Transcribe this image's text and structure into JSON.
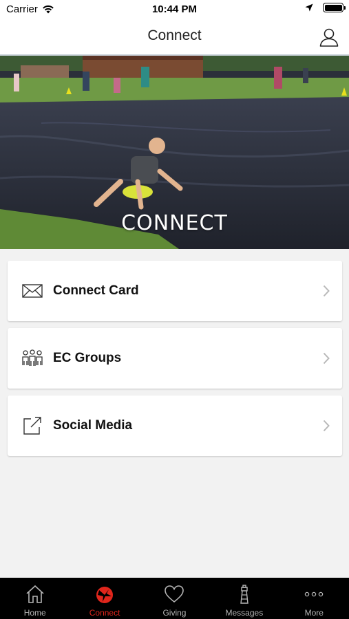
{
  "status_bar": {
    "carrier": "Carrier",
    "time": "10:44 PM",
    "icons": [
      "wifi-icon",
      "location-arrow-icon",
      "battery-icon"
    ],
    "battery_level": 1.0
  },
  "nav": {
    "title": "Connect",
    "profile_icon": "person-icon"
  },
  "hero": {
    "title": "CONNECT"
  },
  "menu": {
    "items": [
      {
        "label": "Connect Card",
        "icon": "envelope-icon"
      },
      {
        "label": "EC Groups",
        "icon": "group-people-icon"
      },
      {
        "label": "Social Media",
        "icon": "external-link-icon"
      }
    ],
    "chevron_icon": "chevron-right-icon"
  },
  "tab_bar": {
    "tabs": [
      {
        "label": "Home",
        "icon": "home-icon",
        "active": false
      },
      {
        "label": "Connect",
        "icon": "connect-logo-icon",
        "active": true
      },
      {
        "label": "Giving",
        "icon": "heart-icon",
        "active": false
      },
      {
        "label": "Messages",
        "icon": "lighthouse-icon",
        "active": false
      },
      {
        "label": "More",
        "icon": "more-dots-icon",
        "active": false
      }
    ]
  },
  "colors": {
    "accent": "#e1261c",
    "tab_bar_bg": "#000000",
    "inactive_tab": "#b5b5b5",
    "page_bg": "#f2f2f2",
    "card_bg": "#ffffff"
  }
}
